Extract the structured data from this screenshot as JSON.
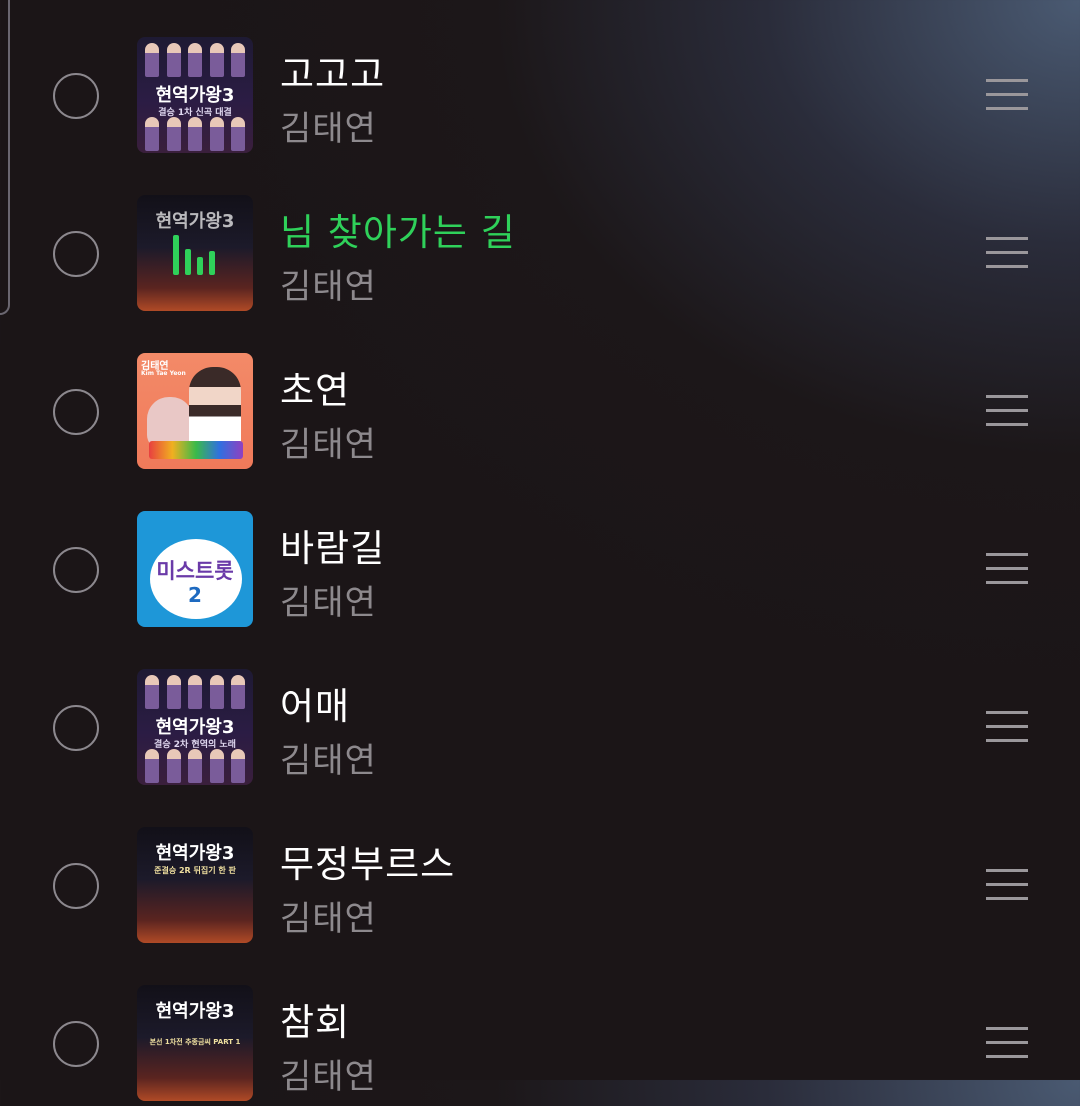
{
  "playlist": {
    "tracks": [
      {
        "title": "고고고",
        "artist": "김태연",
        "playing": false,
        "art": "dark",
        "art_text": "현역가왕3",
        "art_sub": "결승 1차 신곡 대결"
      },
      {
        "title": "님 찾아가는 길",
        "artist": "김태연",
        "playing": true,
        "art": "stage",
        "art_text": "현역가왕3",
        "art_sub": ""
      },
      {
        "title": "초연",
        "artist": "김태연",
        "playing": false,
        "art": "orange",
        "art_text": "김태연",
        "art_sub": "Kim Tae Yeon"
      },
      {
        "title": "바람길",
        "artist": "김태연",
        "playing": false,
        "art": "blue",
        "art_text": "미스트롯",
        "art_sub": "2"
      },
      {
        "title": "어매",
        "artist": "김태연",
        "playing": false,
        "art": "dark",
        "art_text": "현역가왕3",
        "art_sub": "결승 2차 현역의 노래"
      },
      {
        "title": "무정부르스",
        "artist": "김태연",
        "playing": false,
        "art": "stage",
        "art_text": "현역가왕3",
        "art_sub": "준결승 2R 뒤집기 한 판"
      },
      {
        "title": "참회",
        "artist": "김태연",
        "playing": false,
        "art": "stage",
        "art_text": "현역가왕3",
        "art_sub": "본선 1차전 추종금씨 PART 1"
      }
    ],
    "icons": {
      "select": "circle-outline-icon",
      "reorder": "drag-handle-icon",
      "playing": "equalizer-icon"
    },
    "colors": {
      "playing_title": "#2fd15a",
      "title": "#ffffff",
      "artist": "#8d898d"
    }
  }
}
